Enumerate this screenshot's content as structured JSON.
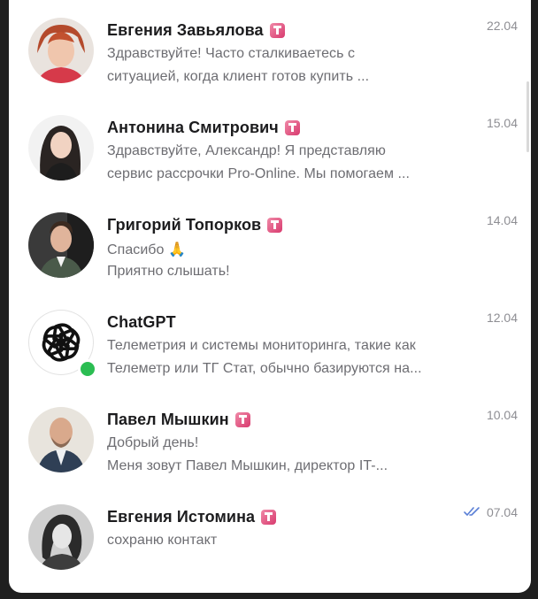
{
  "chats": [
    {
      "name": "Евгения Завьялова",
      "line1": "Здравствуйте! Часто сталкиваетесь с",
      "line2": "ситуацией, когда клиент готов купить ...",
      "date": "22.04",
      "badge_icon": "t-badge-icon"
    },
    {
      "name": "Антонина Смитрович",
      "line1": "Здравствуйте, Александр! Я представляю",
      "line2": "сервис рассрочки Pro-Online. Мы помогаем ...",
      "date": "15.04",
      "badge_icon": "t-badge-icon"
    },
    {
      "name": "Григорий Топорков",
      "line1": "Спасибо 🙏",
      "line2": "Приятно слышать!",
      "date": "14.04",
      "badge_icon": "t-badge-icon"
    },
    {
      "name": "ChatGPT",
      "line1": "Телеметрия и системы мониторинга, такие как",
      "line2": "Телеметр или ТГ Стат, обычно базируются на...",
      "date": "12.04",
      "status": "online"
    },
    {
      "name": "Павел Мышкин",
      "line1": "Добрый день!",
      "line2": "Меня зовут Павел Мышкин, директор IT-...",
      "date": "10.04",
      "badge_icon": "t-badge-icon"
    },
    {
      "name": "Евгения Истомина",
      "line1": "сохраню контакт",
      "line2": "",
      "date": "07.04",
      "badge_icon": "t-badge-icon",
      "read_icon": "double-check-icon"
    }
  ],
  "colors": {
    "badge": "#e04a7a",
    "online": "#2bbd52",
    "read_check": "#5a7fd6"
  }
}
